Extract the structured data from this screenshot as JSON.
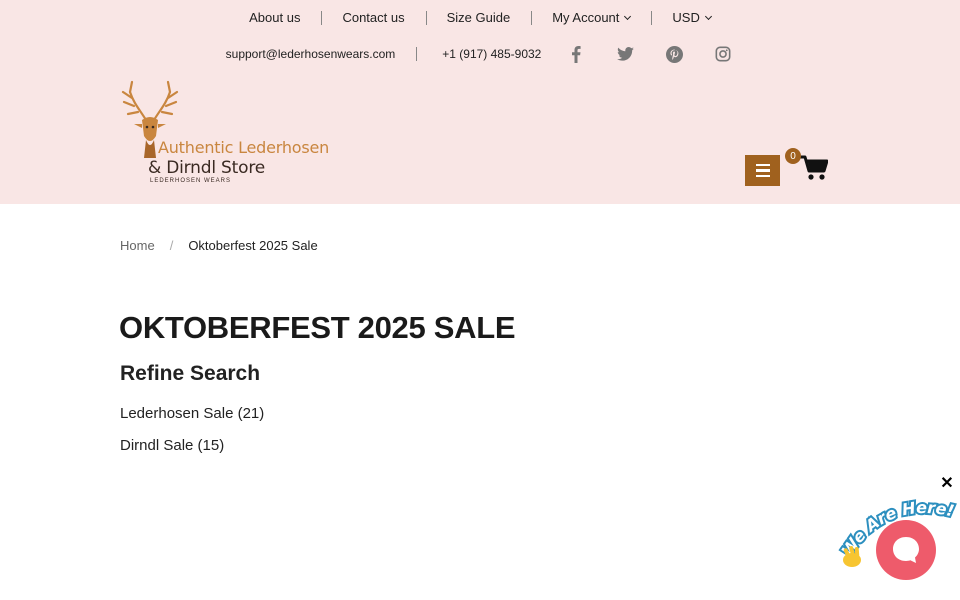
{
  "top_nav": {
    "about": "About us",
    "contact": "Contact us",
    "size_guide": "Size Guide",
    "account": "My Account",
    "currency": "USD"
  },
  "contact_bar": {
    "email": "support@lederhosenwears.com",
    "phone": "+1 (917) 485-9032",
    "social": [
      "facebook-icon",
      "twitter-icon",
      "pinterest-icon",
      "instagram-icon"
    ]
  },
  "logo": {
    "line1": "Authentic Lederhosen",
    "line2": "& Dirndl Store",
    "line3": "LEDERHOSEN WEARS"
  },
  "cart": {
    "count": "0"
  },
  "breadcrumb": {
    "home": "Home",
    "separator": "/",
    "current": "Oktoberfest 2025 Sale"
  },
  "main": {
    "title": "OKTOBERFEST 2025 SALE",
    "refine": "Refine Search",
    "filters": [
      "Lederhosen Sale (21)",
      "Dirndl Sale (15)"
    ]
  },
  "chat": {
    "badge_text": "We Are Here!",
    "close": "✕"
  },
  "colors": {
    "header_bg": "#f9e6e5",
    "accent": "#a0611e",
    "chat": "#ee5b6b",
    "logo_orange": "#c9863f"
  }
}
